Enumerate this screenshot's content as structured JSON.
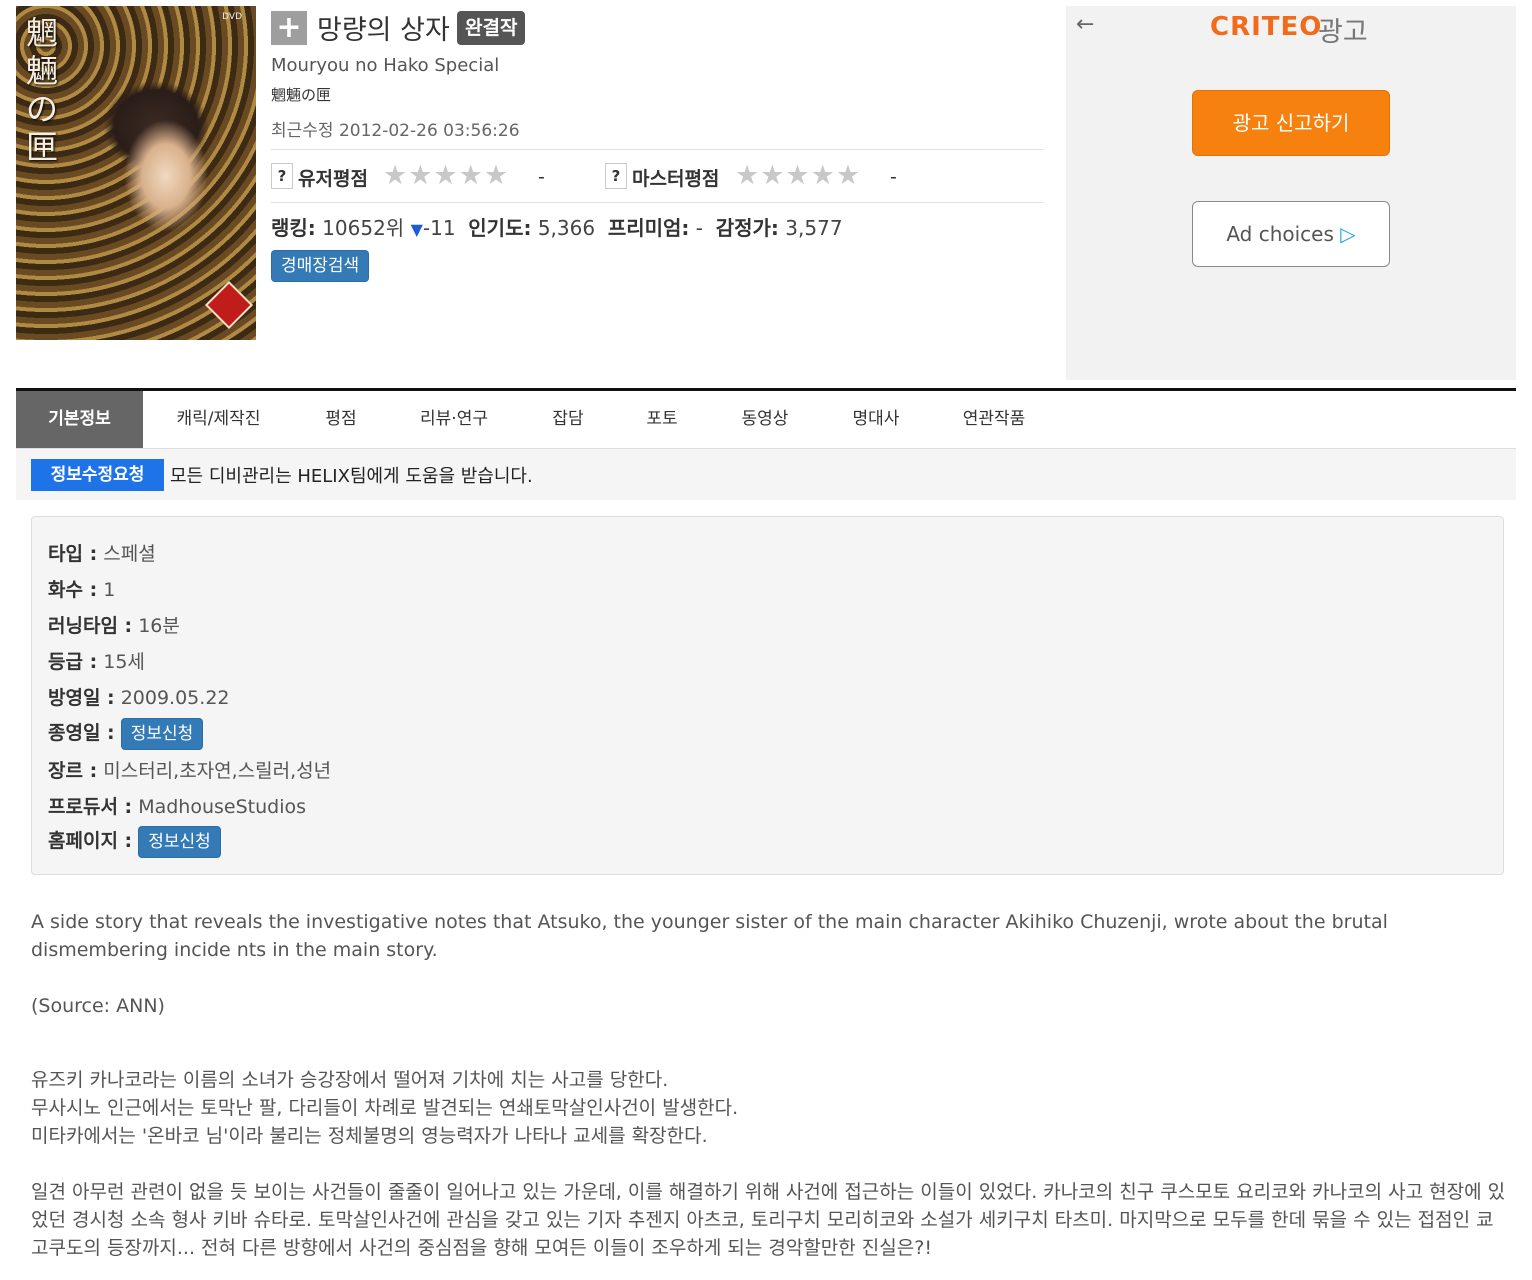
{
  "work": {
    "title": "망량의 상자",
    "status_badge": "완결작",
    "title_en": "Mouryou no Hako Special",
    "title_jp": "魍魎の匣",
    "modified": "최근수정 2012-02-26 03:56:26",
    "poster_text": "魍魎の匣",
    "poster_dvd": "DVD"
  },
  "ratings": {
    "user_label": "유저평점",
    "user_value": "-",
    "master_label": "마스터평점",
    "master_value": "-",
    "help_icon": "?",
    "stars": "★★★★★",
    "star_rating": 0
  },
  "stats": {
    "rank_label": "랭킹:",
    "rank_value": "10652위",
    "rank_change": "-11",
    "rank_change_icon": "▼",
    "popularity_label": "인기도:",
    "popularity_value": "5,366",
    "premium_label": "프리미엄:",
    "premium_value": "-",
    "appraisal_label": "감정가:",
    "appraisal_value": "3,577",
    "auction_button": "경매장검색"
  },
  "ad": {
    "back_icon": "←",
    "brand": "CRITEO",
    "brand_sub": "광고",
    "report_button": "광고 신고하기",
    "choices_label": "Ad choices",
    "choices_icon": "▷"
  },
  "tabs": [
    {
      "label": "기본정보",
      "active": true
    },
    {
      "label": "캐릭/제작진"
    },
    {
      "label": "평점"
    },
    {
      "label": "리뷰·연구"
    },
    {
      "label": "잡담"
    },
    {
      "label": "포토"
    },
    {
      "label": "동영상"
    },
    {
      "label": "명대사"
    },
    {
      "label": "연관작품"
    }
  ],
  "notice": {
    "button": "정보수정요청",
    "text": "모든 디비관리는 HELIX팀에게 도움을 받습니다."
  },
  "info": {
    "type_label": "타입 :",
    "type_value": "스페셜",
    "episodes_label": "화수 :",
    "episodes_value": "1",
    "runtime_label": "러닝타임 :",
    "runtime_value": "16분",
    "rating_label": "등급 :",
    "rating_value": "15세",
    "aired_label": "방영일 :",
    "aired_value": "2009.05.22",
    "ended_label": "종영일 :",
    "ended_button": "정보신청",
    "genre_label": "장르 :",
    "genre_value": "미스터리,초자연,스릴러,성년",
    "producer_label": "프로듀서 :",
    "producer_value": "MadhouseStudios",
    "homepage_label": "홈페이지 :",
    "homepage_button": "정보신청"
  },
  "description": {
    "en": "A side story that reveals the investigative notes that Atsuko, the younger sister of the main character Akihiko Chuzenji, wrote about the brutal dismembering incide nts in the main story.",
    "source": "(Source: ANN)",
    "ko_line1": "유즈키 카나코라는 이름의 소녀가 승강장에서 떨어져 기차에 치는 사고를 당한다.",
    "ko_line2": "무사시노 인근에서는 토막난 팔, 다리들이 차례로 발견되는 연쇄토막살인사건이 발생한다.",
    "ko_line3": "미타카에서는 '온바코 님'이라 불리는 정체불명의 영능력자가 나타나 교세를 확장한다.",
    "ko_para2": "일견 아무런 관련이 없을 듯 보이는 사건들이 줄줄이 일어나고 있는 가운데, 이를 해결하기 위해 사건에 접근하는 이들이 있었다. 카나코의 친구 쿠스모토 요리코와 카나코의 사고 현장에 있었던 경시청 소속 형사 키바 슈타로. 토막살인사건에 관심을 갖고 있는 기자 추젠지 아츠코, 토리구치 모리히코와 소설가 세키구치 타츠미. 마지막으로 모두를 한데 묶을 수 있는 접점인 쿄고쿠도의 등장까지... 전혀 다른 방향에서 사건의 중심점을 향해 모여든 이들이 조우하게 되는 경악할만한 진실은?!"
  }
}
